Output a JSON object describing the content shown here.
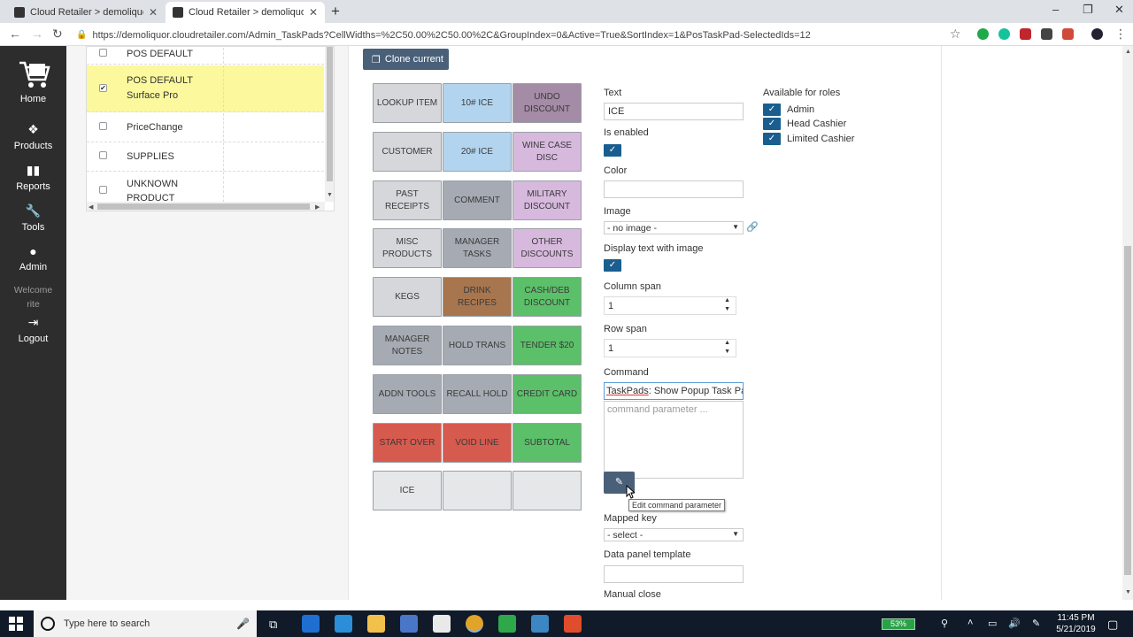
{
  "browser": {
    "tabs": [
      {
        "title": "Cloud Retailer > demoliquor > Ta",
        "active": false
      },
      {
        "title": "Cloud Retailer > demoliquor > Ta",
        "active": true
      }
    ],
    "new_tab": "+",
    "url": "https://demoliquor.cloudretailer.com/Admin_TaskPads?CellWidths=%2C50.00%2C50.00%2C&GroupIndex=0&Active=True&SortIndex=1&PosTaskPad-SelectedIds=12"
  },
  "sidebar": {
    "items": [
      {
        "label": "Home",
        "icon": "cart-icon"
      },
      {
        "label": "Products",
        "icon": "cubes-icon"
      },
      {
        "label": "Reports",
        "icon": "bar-chart-icon"
      },
      {
        "label": "Tools",
        "icon": "wrench-icon"
      },
      {
        "label": "Admin",
        "icon": "user-icon"
      }
    ],
    "welcome": "Welcome",
    "user": "rite",
    "logout": "Logout"
  },
  "taskpad_list": {
    "rows": [
      {
        "line1": "POS DEFAULT",
        "line2": "",
        "checked": false,
        "selected": false
      },
      {
        "line1": "POS DEFAULT",
        "line2": "Surface Pro",
        "checked": true,
        "selected": true
      },
      {
        "line1": "PriceChange",
        "line2": "",
        "checked": false,
        "selected": false
      },
      {
        "line1": "SUPPLIES",
        "line2": "",
        "checked": false,
        "selected": false
      },
      {
        "line1": "UNKNOWN",
        "line2": "PRODUCT",
        "checked": false,
        "selected": false
      }
    ]
  },
  "editor": {
    "clone_button": "Clone current",
    "keys": [
      {
        "label": "LOOKUP ITEM",
        "color": "#d5d7da"
      },
      {
        "label": "10# ICE",
        "color": "#b3d4ee"
      },
      {
        "label": "UNDO DISCOUNT",
        "color": "#a48ba6"
      },
      {
        "label": "CUSTOMER",
        "color": "#d5d7da"
      },
      {
        "label": "20# ICE",
        "color": "#b3d4ee"
      },
      {
        "label": "WINE CASE DISC",
        "color": "#d7b9de"
      },
      {
        "label": "PAST RECEIPTS",
        "color": "#d5d7da"
      },
      {
        "label": "COMMENT",
        "color": "#a6abb3"
      },
      {
        "label": "MILITARY DISCOUNT",
        "color": "#d7b9de"
      },
      {
        "label": "MISC PRODUCTS",
        "color": "#d5d7da"
      },
      {
        "label": "MANAGER TASKS",
        "color": "#a6abb3"
      },
      {
        "label": "OTHER DISCOUNTS",
        "color": "#d7b9de"
      },
      {
        "label": "KEGS",
        "color": "#d5d7da"
      },
      {
        "label": "DRINK RECIPES",
        "color": "#a7764f"
      },
      {
        "label": "CASH/DEB DISCOUNT",
        "color": "#5cbf6a"
      },
      {
        "label": "MANAGER NOTES",
        "color": "#a6abb3"
      },
      {
        "label": "HOLD TRANS",
        "color": "#a6abb3"
      },
      {
        "label": "TENDER $20",
        "color": "#5cbf6a"
      },
      {
        "label": "ADDN TOOLS",
        "color": "#a6abb3"
      },
      {
        "label": "RECALL HOLD",
        "color": "#a6abb3"
      },
      {
        "label": "CREDIT CARD",
        "color": "#5cbf6a"
      },
      {
        "label": "START OVER",
        "color": "#d75a4f"
      },
      {
        "label": "VOID LINE",
        "color": "#d75a4f"
      },
      {
        "label": "SUBTOTAL",
        "color": "#5cbf6a"
      },
      {
        "label": "ICE",
        "color": "#e6e7e9"
      },
      {
        "label": "",
        "color": "#e6e7e9"
      },
      {
        "label": "",
        "color": "#e6e7e9"
      }
    ],
    "fields": {
      "text_label": "Text",
      "text_value": "ICE",
      "enabled_label": "Is enabled",
      "enabled": true,
      "color_label": "Color",
      "color_value": "",
      "image_label": "Image",
      "image_value": "- no image -",
      "display_text_label": "Display text with image",
      "display_text": true,
      "colspan_label": "Column span",
      "colspan_value": "1",
      "rowspan_label": "Row span",
      "rowspan_value": "1",
      "command_label": "Command",
      "command_prefix": "TaskPads",
      "command_rest": ": Show Popup Task Pad",
      "command_param_placeholder": "command parameter ...",
      "edit_tooltip": "Edit command parameter",
      "mapped_key_label": "Mapped key",
      "mapped_key_value": "- select -",
      "data_panel_label": "Data panel template",
      "data_panel_value": "",
      "manual_close_label": "Manual close"
    },
    "roles_label": "Available for roles",
    "roles": [
      {
        "name": "Admin",
        "checked": true
      },
      {
        "name": "Head Cashier",
        "checked": true
      },
      {
        "name": "Limited Cashier",
        "checked": true
      }
    ]
  },
  "taskbar": {
    "search_placeholder": "Type here to search",
    "battery": "53%",
    "time": "11:45 PM",
    "date": "5/21/2019"
  }
}
